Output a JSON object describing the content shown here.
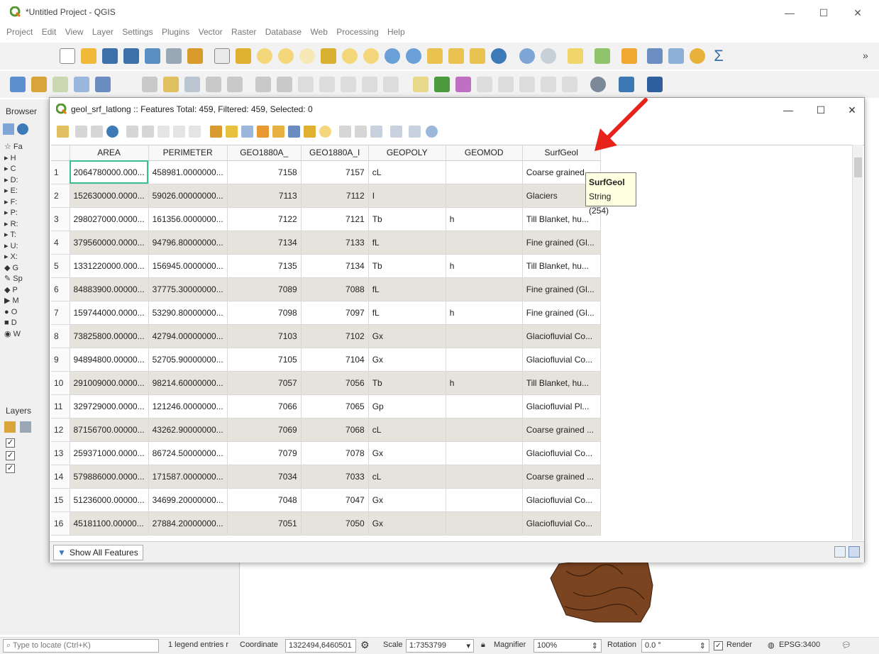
{
  "window": {
    "title": "*Untitled Project - QGIS",
    "minimize": "—",
    "maximize": "☐",
    "close": "✕"
  },
  "menubar": [
    "Project",
    "Edit",
    "View",
    "Layer",
    "Settings",
    "Plugins",
    "Vector",
    "Raster",
    "Database",
    "Web",
    "Processing",
    "Help"
  ],
  "toolbar_overflow": "»",
  "left_dock": {
    "browser_title": "Browser",
    "layers_title": "Layers",
    "browser_items": [
      "Fa",
      "H",
      "C",
      "D:",
      "E:",
      "F:",
      "P:",
      "R:",
      "T:",
      "U:",
      "X:",
      "G",
      "Sp",
      "P",
      "M",
      "O",
      "D",
      "W"
    ]
  },
  "attribute_table": {
    "title": "geol_srf_latlong :: Features Total: 459, Filtered: 459, Selected: 0",
    "minimize": "—",
    "maximize": "☐",
    "close": "✕",
    "columns": [
      "AREA",
      "PERIMETER",
      "GEO1880A_",
      "GEO1880A_I",
      "GEOPOLY",
      "GEOMOD",
      "SurfGeol"
    ],
    "rows": [
      {
        "n": "1",
        "area": "2064780000.000...",
        "perimeter": "458981.0000000...",
        "geo1880a": "7158",
        "geo1880a_i": "7157",
        "geopoly": "cL",
        "geomod": "",
        "surfgeol": "Coarse grained ..."
      },
      {
        "n": "2",
        "area": "152630000.0000...",
        "perimeter": "59026.00000000...",
        "geo1880a": "7113",
        "geo1880a_i": "7112",
        "geopoly": "I",
        "geomod": "",
        "surfgeol": "Glaciers"
      },
      {
        "n": "3",
        "area": "298027000.0000...",
        "perimeter": "161356.0000000...",
        "geo1880a": "7122",
        "geo1880a_i": "7121",
        "geopoly": "Tb",
        "geomod": "h",
        "surfgeol": "Till Blanket, hu..."
      },
      {
        "n": "4",
        "area": "379560000.0000...",
        "perimeter": "94796.80000000...",
        "geo1880a": "7134",
        "geo1880a_i": "7133",
        "geopoly": "fL",
        "geomod": "",
        "surfgeol": "Fine grained (Gl..."
      },
      {
        "n": "5",
        "area": "1331220000.000...",
        "perimeter": "156945.0000000...",
        "geo1880a": "7135",
        "geo1880a_i": "7134",
        "geopoly": "Tb",
        "geomod": "h",
        "surfgeol": "Till Blanket, hu..."
      },
      {
        "n": "6",
        "area": "84883900.00000...",
        "perimeter": "37775.30000000...",
        "geo1880a": "7089",
        "geo1880a_i": "7088",
        "geopoly": "fL",
        "geomod": "",
        "surfgeol": "Fine grained (Gl..."
      },
      {
        "n": "7",
        "area": "159744000.0000...",
        "perimeter": "53290.80000000...",
        "geo1880a": "7098",
        "geo1880a_i": "7097",
        "geopoly": "fL",
        "geomod": "h",
        "surfgeol": "Fine grained (Gl..."
      },
      {
        "n": "8",
        "area": "73825800.00000...",
        "perimeter": "42794.00000000...",
        "geo1880a": "7103",
        "geo1880a_i": "7102",
        "geopoly": "Gx",
        "geomod": "",
        "surfgeol": "Glaciofluvial Co..."
      },
      {
        "n": "9",
        "area": "94894800.00000...",
        "perimeter": "52705.90000000...",
        "geo1880a": "7105",
        "geo1880a_i": "7104",
        "geopoly": "Gx",
        "geomod": "",
        "surfgeol": "Glaciofluvial Co..."
      },
      {
        "n": "10",
        "area": "291009000.0000...",
        "perimeter": "98214.60000000...",
        "geo1880a": "7057",
        "geo1880a_i": "7056",
        "geopoly": "Tb",
        "geomod": "h",
        "surfgeol": "Till Blanket, hu..."
      },
      {
        "n": "11",
        "area": "329729000.0000...",
        "perimeter": "121246.0000000...",
        "geo1880a": "7066",
        "geo1880a_i": "7065",
        "geopoly": "Gp",
        "geomod": "",
        "surfgeol": "Glaciofluvial Pl..."
      },
      {
        "n": "12",
        "area": "87156700.00000...",
        "perimeter": "43262.90000000...",
        "geo1880a": "7069",
        "geo1880a_i": "7068",
        "geopoly": "cL",
        "geomod": "",
        "surfgeol": "Coarse grained ..."
      },
      {
        "n": "13",
        "area": "259371000.0000...",
        "perimeter": "86724.50000000...",
        "geo1880a": "7079",
        "geo1880a_i": "7078",
        "geopoly": "Gx",
        "geomod": "",
        "surfgeol": "Glaciofluvial Co..."
      },
      {
        "n": "14",
        "area": "579886000.0000...",
        "perimeter": "171587.0000000...",
        "geo1880a": "7034",
        "geo1880a_i": "7033",
        "geopoly": "cL",
        "geomod": "",
        "surfgeol": "Coarse grained ..."
      },
      {
        "n": "15",
        "area": "51236000.00000...",
        "perimeter": "34699.20000000...",
        "geo1880a": "7048",
        "geo1880a_i": "7047",
        "geopoly": "Gx",
        "geomod": "",
        "surfgeol": "Glaciofluvial Co..."
      },
      {
        "n": "16",
        "area": "45181100.00000...",
        "perimeter": "27884.20000000...",
        "geo1880a": "7051",
        "geo1880a_i": "7050",
        "geopoly": "Gx",
        "geomod": "",
        "surfgeol": "Glaciofluvial Co..."
      }
    ],
    "tooltip": {
      "title": "SurfGeol",
      "type": "String (254)"
    },
    "show_all_features": "Show All Features"
  },
  "statusbar": {
    "locator_placeholder": "Type to locate (Ctrl+K)",
    "legend_msg": "1 legend entries r",
    "coordinate_label": "Coordinate",
    "coordinate_value": "1322494,6460501",
    "scale_label": "Scale",
    "scale_value": "1:7353799",
    "magnifier_label": "Magnifier",
    "magnifier_value": "100%",
    "rotation_label": "Rotation",
    "rotation_value": "0.0 °",
    "render_label": "Render",
    "crs": "EPSG:3400"
  },
  "colors": {
    "alt_row": "#e6e3dc",
    "selection_outline": "#3cbf8f",
    "annotation_arrow": "#e8231c",
    "map_polygon": "#7a4420"
  }
}
